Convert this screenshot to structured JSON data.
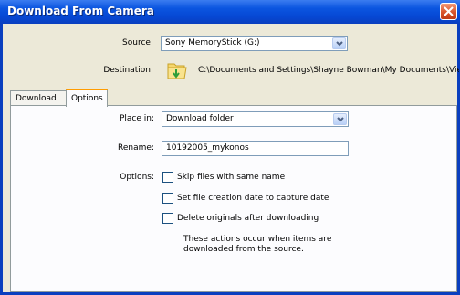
{
  "window": {
    "title": "Download From Camera"
  },
  "source": {
    "label": "Source:",
    "value": "Sony MemoryStick (G:)"
  },
  "destination": {
    "label": "Destination:",
    "path": "C:\\Documents and Settings\\Shayne Bowman\\My Documents\\View"
  },
  "tabs": [
    {
      "label": "Download",
      "active": false
    },
    {
      "label": "Options",
      "active": true
    }
  ],
  "options_panel": {
    "place_in": {
      "label": "Place in:",
      "value": "Download folder"
    },
    "rename": {
      "label": "Rename:",
      "value": "10192005_mykonos"
    },
    "options_label": "Options:",
    "checkboxes": [
      {
        "label": "Skip files with same name",
        "checked": false
      },
      {
        "label": "Set file creation date to capture date",
        "checked": false
      },
      {
        "label": "Delete originals after downloading",
        "checked": false
      }
    ],
    "note_line1": "These actions occur when items are",
    "note_line2": "downloaded from the source."
  },
  "colors": {
    "titlebar": "#0B55E0",
    "tab_accent": "#FF9C00",
    "dialog_bg": "#ECE9D8"
  }
}
